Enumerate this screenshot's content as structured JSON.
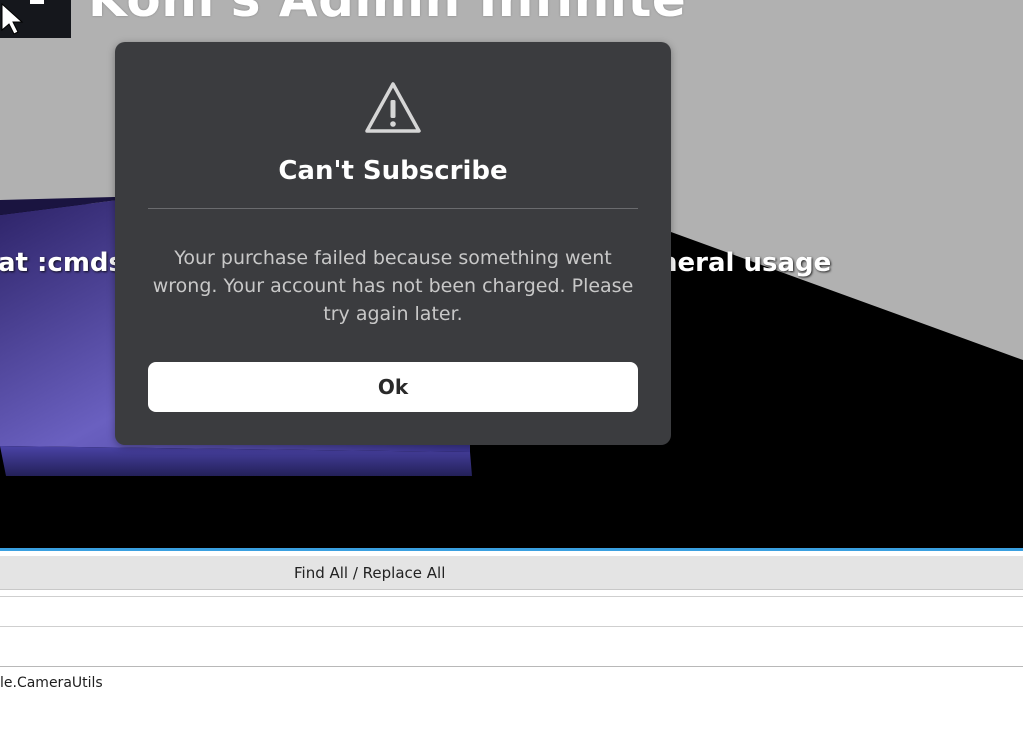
{
  "game": {
    "title_text": "Kohl's Admin Infinite",
    "hint_left": "at :cmds",
    "hint_right": "neral usage"
  },
  "dialog": {
    "icon": "warning-triangle-icon",
    "title": "Can't Subscribe",
    "message": "Your purchase failed because something went wrong. Your account has not been charged. Please try again later.",
    "ok_label": "Ok"
  },
  "editor_panel": {
    "find_label": "Find All / Replace All",
    "results": [
      "",
      "",
      "le.CameraUtils"
    ]
  },
  "colors": {
    "dialog_bg": "#3b3c3f",
    "accent": "#3aa0e0",
    "sky": "#b1b1b1",
    "ground": "#000000",
    "platform": "#6e63c2"
  }
}
